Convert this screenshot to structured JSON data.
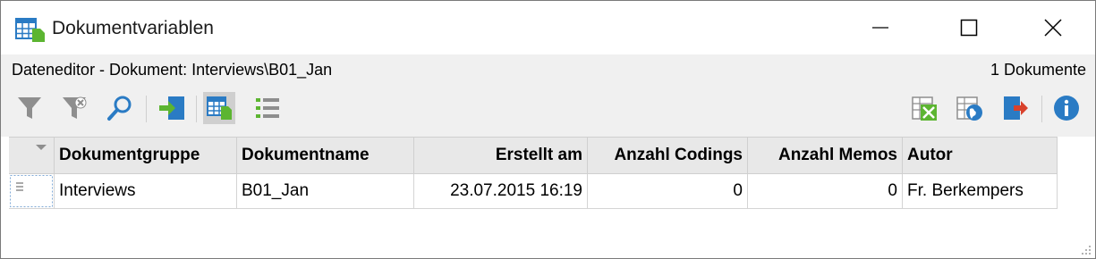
{
  "window": {
    "title": "Dokumentvariablen",
    "icon": "table-document-icon",
    "controls": [
      "minimize-icon",
      "maximize-icon",
      "close-icon"
    ]
  },
  "subheader": {
    "path": "Dateneditor - Dokument: Interviews\\B01_Jan",
    "count": "1 Dokumente"
  },
  "toolbar": {
    "left_icons": [
      "filter-icon",
      "clear-filter-icon",
      "search-icon",
      "import-icon",
      "table-view-icon",
      "list-view-icon"
    ],
    "active": "table-view-icon",
    "right_icons": [
      "excel-export-icon",
      "html-export-icon",
      "export-icon",
      "info-icon"
    ],
    "colors": {
      "green": "#5cb531",
      "blue": "#2a7bc4",
      "red": "#d9412b",
      "gray": "#8e8e8e"
    }
  },
  "table": {
    "columns": [
      "Dokumentgruppe",
      "Dokumentname",
      "Erstellt am",
      "Anzahl Codings",
      "Anzahl Memos",
      "Autor"
    ],
    "rows": [
      [
        "Interviews",
        "B01_Jan",
        "23.07.2015 16:19",
        "0",
        "0",
        "Fr. Berkempers"
      ]
    ]
  }
}
